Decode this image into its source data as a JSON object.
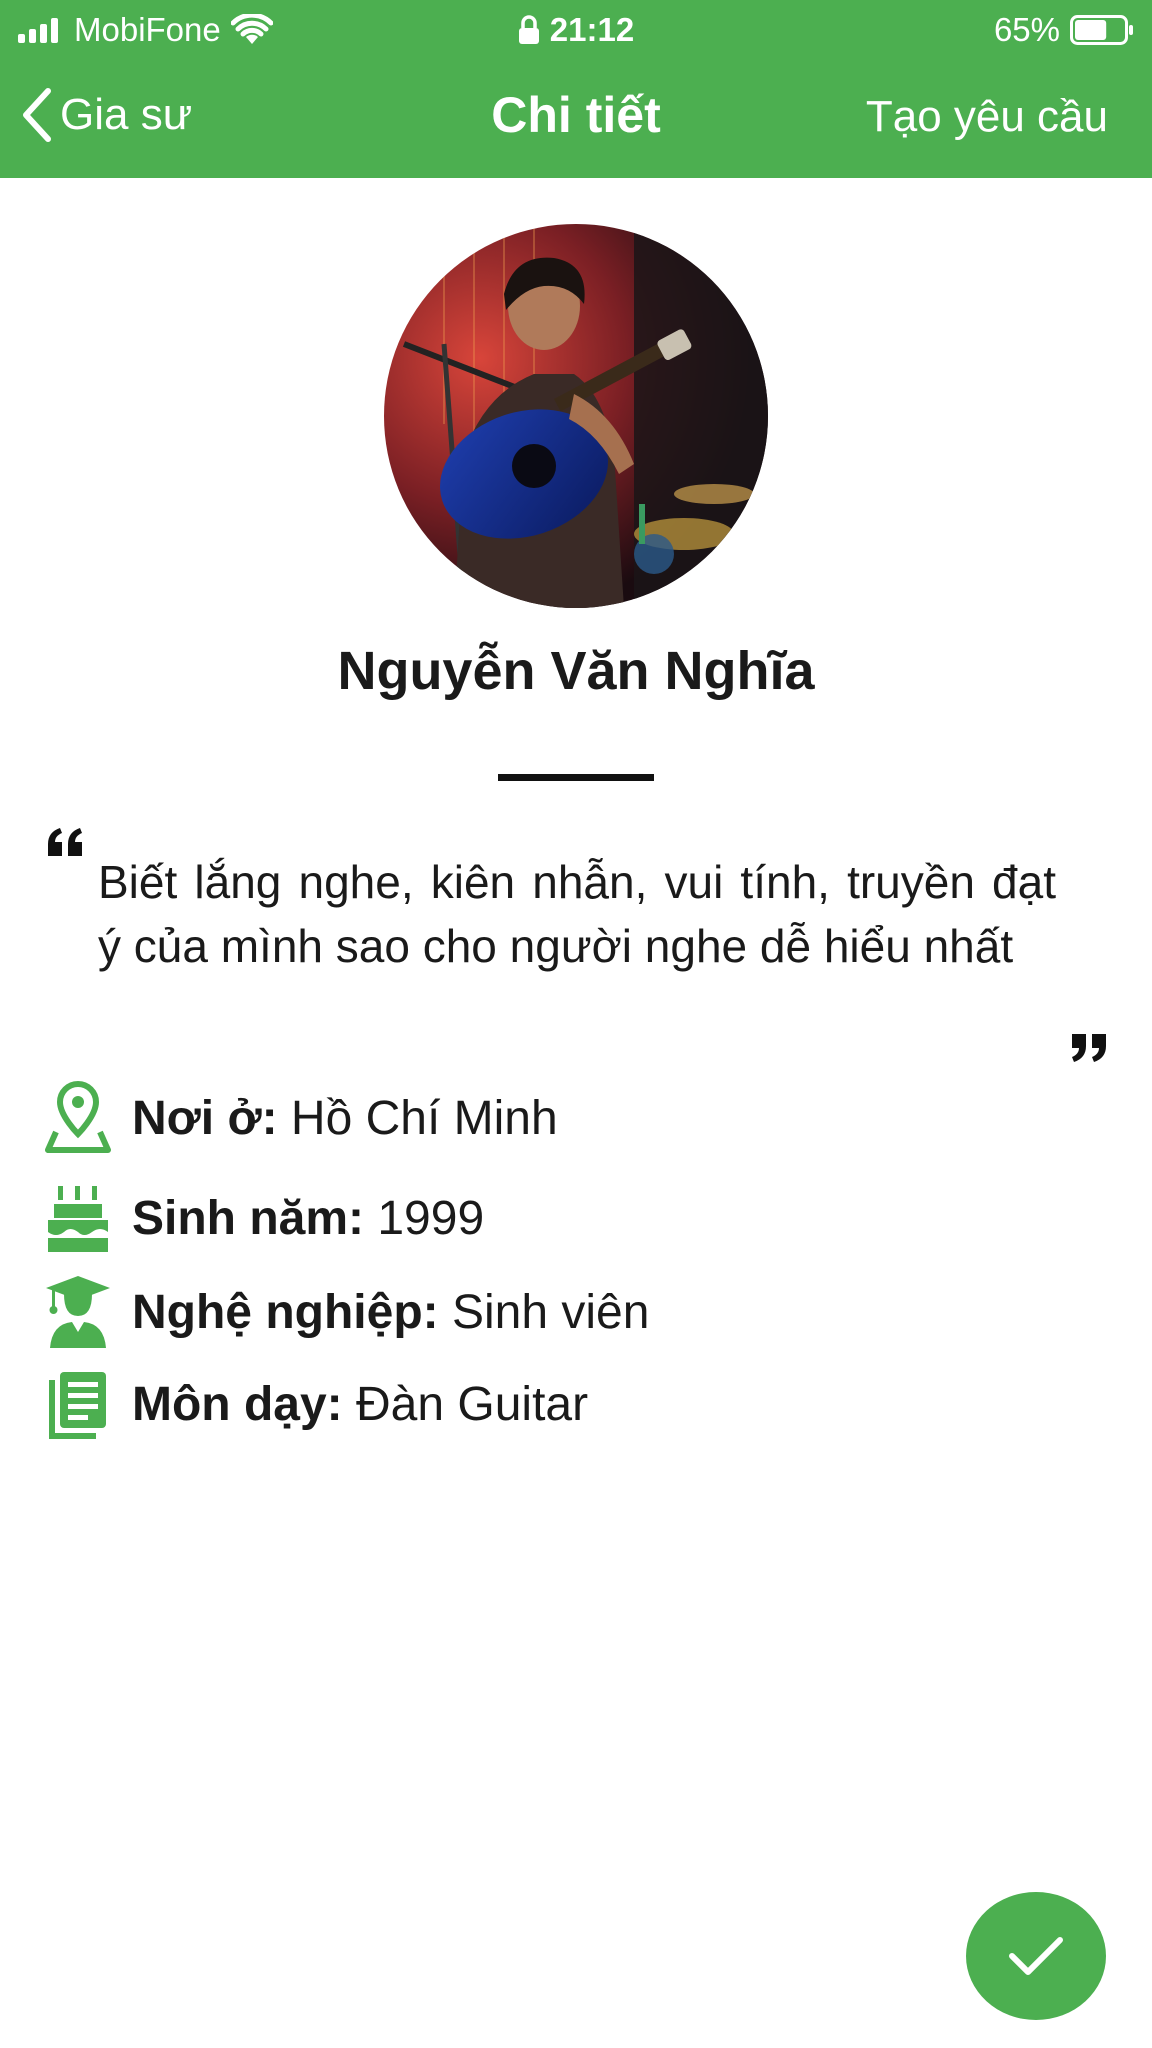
{
  "status_bar": {
    "carrier": "MobiFone",
    "time": "21:12",
    "battery": "65%",
    "battery_level": 0.65
  },
  "nav": {
    "back_label": "Gia sư",
    "title": "Chi tiết",
    "action_label": "Tạo yêu cầu"
  },
  "profile": {
    "name": "Nguyễn Văn Nghĩa",
    "bio": "Biết lắng nghe, kiên nhẫn, vui tính, truyền đạt ý của mình sao cho người nghe dễ hiểu nhất"
  },
  "details": [
    {
      "icon": "map-pin-icon",
      "label": "Nơi ở:",
      "value": " Hồ Chí Minh"
    },
    {
      "icon": "birthday-cake-icon",
      "label": "Sinh năm:",
      "value": " 1999"
    },
    {
      "icon": "graduate-icon",
      "label": "Nghệ nghiệp:",
      "value": " Sinh viên"
    },
    {
      "icon": "book-icon",
      "label": "Môn dạy:",
      "value": " Đàn Guitar"
    }
  ],
  "colors": {
    "brand_green": "#4caf50",
    "text": "#1a1a1a"
  }
}
